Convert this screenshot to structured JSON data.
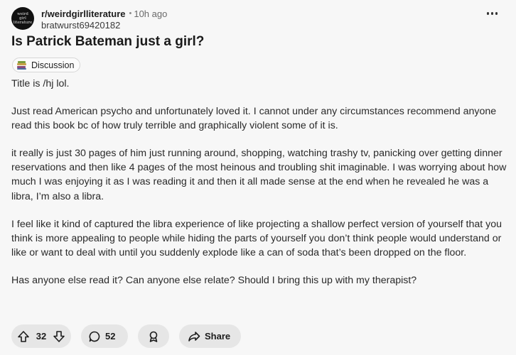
{
  "post": {
    "subreddit": "r/weirdgirlliterature",
    "separator": "•",
    "time": "10h ago",
    "username": "bratwurst69420182",
    "avatar_text": "weird girl literature",
    "title": "Is Patrick Bateman just a girl?",
    "flair": "Discussion",
    "flair_icon": "books-icon",
    "body": [
      "Title is /hj lol.",
      "Just read American psycho and unfortunately loved it. I cannot under any circumstances recommend anyone read this book bc of how truly terrible and graphically violent some of it is.",
      "it really is just 30 pages of him just running around, shopping, watching trashy tv, panicking over getting dinner reservations and then like 4 pages of the most heinous and troubling shit imaginable. I was worrying about how much I was enjoying it as I was reading it and then it all made sense at the end when he revealed he was a libra, I’m also a libra.",
      "I feel like it kind of captured the libra experience of like projecting a shallow perfect version of yourself that you think is more appealing to people while hiding the parts of yourself you don’t think people would understand or like or want to deal with until you suddenly explode like a can of soda that’s been dropped on the floor.",
      "Has anyone else read it? Can anyone else relate? Should I bring this up with my therapist?"
    ]
  },
  "actions": {
    "score": "32",
    "comments": "52",
    "share_label": "Share"
  },
  "colors": {
    "background": "#f7f7f7",
    "pill": "#e6e6e6",
    "text": "#1c1c1c"
  }
}
